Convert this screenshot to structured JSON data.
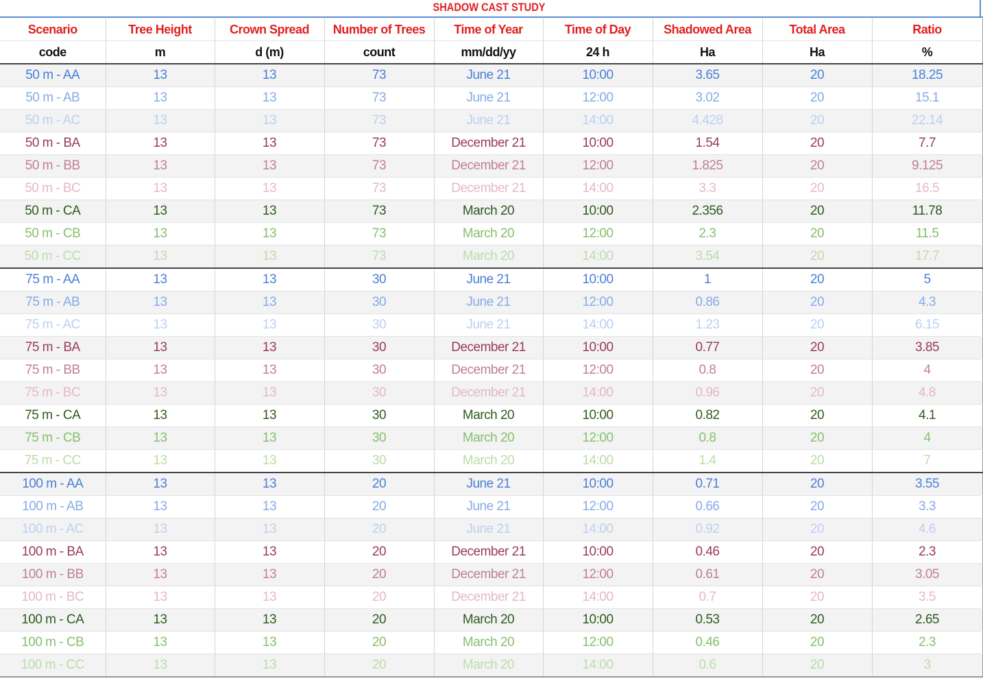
{
  "title": "SHADOW CAST STUDY",
  "colors": {
    "header_red": "#e02020",
    "AA": "#4a7fd8",
    "AB": "#86abe8",
    "AC": "#bcd0f2",
    "BA": "#9a3a5a",
    "BB": "#c07f98",
    "BC": "#e4b8c8",
    "CA": "#2e5b1e",
    "CB": "#86c06c",
    "CC": "#bcdcaa"
  },
  "headers": [
    "Scenario",
    "Tree Height",
    "Crown Spread",
    "Number of Trees",
    "Time of Year",
    "Time of Day",
    "Shadowed Area",
    "Total Area",
    "Ratio"
  ],
  "units": [
    "code",
    "m",
    "d (m)",
    "count",
    "mm/dd/yy",
    "24 h",
    "Ha",
    "Ha",
    "%"
  ],
  "rows": [
    {
      "tone": "AA",
      "cells": [
        "50 m - AA",
        "13",
        "13",
        "73",
        "June 21",
        "10:00",
        "3.65",
        "20",
        "18.25"
      ]
    },
    {
      "tone": "AB",
      "cells": [
        "50 m - AB",
        "13",
        "13",
        "73",
        "June 21",
        "12:00",
        "3.02",
        "20",
        "15.1"
      ]
    },
    {
      "tone": "AC",
      "cells": [
        "50 m - AC",
        "13",
        "13",
        "73",
        "June 21",
        "14:00",
        "4.428",
        "20",
        "22.14"
      ]
    },
    {
      "tone": "BA",
      "cells": [
        "50 m - BA",
        "13",
        "13",
        "73",
        "December 21",
        "10:00",
        "1.54",
        "20",
        "7.7"
      ]
    },
    {
      "tone": "BB",
      "cells": [
        "50 m - BB",
        "13",
        "13",
        "73",
        "December 21",
        "12:00",
        "1.825",
        "20",
        "9.125"
      ]
    },
    {
      "tone": "BC",
      "cells": [
        "50 m - BC",
        "13",
        "13",
        "73",
        "December 21",
        "14:00",
        "3.3",
        "20",
        "16.5"
      ]
    },
    {
      "tone": "CA",
      "cells": [
        "50 m - CA",
        "13",
        "13",
        "73",
        "March 20",
        "10:00",
        "2.356",
        "20",
        "11.78"
      ]
    },
    {
      "tone": "CB",
      "cells": [
        "50 m - CB",
        "13",
        "13",
        "73",
        "March 20",
        "12:00",
        "2.3",
        "20",
        "11.5"
      ]
    },
    {
      "tone": "CC",
      "cells": [
        "50 m - CC",
        "13",
        "13",
        "73",
        "March 20",
        "14:00",
        "3.54",
        "20",
        "17.7"
      ]
    },
    {
      "tone": "AA",
      "cells": [
        "75 m - AA",
        "13",
        "13",
        "30",
        "June 21",
        "10:00",
        "1",
        "20",
        "5"
      ]
    },
    {
      "tone": "AB",
      "cells": [
        "75 m - AB",
        "13",
        "13",
        "30",
        "June 21",
        "12:00",
        "0.86",
        "20",
        "4.3"
      ]
    },
    {
      "tone": "AC",
      "cells": [
        "75 m - AC",
        "13",
        "13",
        "30",
        "June 21",
        "14:00",
        "1.23",
        "20",
        "6.15"
      ]
    },
    {
      "tone": "BA",
      "cells": [
        "75 m - BA",
        "13",
        "13",
        "30",
        "December 21",
        "10:00",
        "0.77",
        "20",
        "3.85"
      ]
    },
    {
      "tone": "BB",
      "cells": [
        "75 m - BB",
        "13",
        "13",
        "30",
        "December 21",
        "12:00",
        "0.8",
        "20",
        "4"
      ]
    },
    {
      "tone": "BC",
      "cells": [
        "75 m - BC",
        "13",
        "13",
        "30",
        "December 21",
        "14:00",
        "0.96",
        "20",
        "4.8"
      ]
    },
    {
      "tone": "CA",
      "cells": [
        "75 m - CA",
        "13",
        "13",
        "30",
        "March 20",
        "10:00",
        "0.82",
        "20",
        "4.1"
      ]
    },
    {
      "tone": "CB",
      "cells": [
        "75 m - CB",
        "13",
        "13",
        "30",
        "March 20",
        "12:00",
        "0.8",
        "20",
        "4"
      ]
    },
    {
      "tone": "CC",
      "cells": [
        "75 m - CC",
        "13",
        "13",
        "30",
        "March 20",
        "14:00",
        "1.4",
        "20",
        "7"
      ]
    },
    {
      "tone": "AA",
      "cells": [
        "100 m - AA",
        "13",
        "13",
        "20",
        "June 21",
        "10:00",
        "0.71",
        "20",
        "3.55"
      ]
    },
    {
      "tone": "AB",
      "cells": [
        "100 m - AB",
        "13",
        "13",
        "20",
        "June 21",
        "12:00",
        "0.66",
        "20",
        "3.3"
      ]
    },
    {
      "tone": "AC",
      "cells": [
        "100 m - AC",
        "13",
        "13",
        "20",
        "June 21",
        "14:00",
        "0.92",
        "20",
        "4.6"
      ]
    },
    {
      "tone": "BA",
      "cells": [
        "100 m - BA",
        "13",
        "13",
        "20",
        "December 21",
        "10:00",
        "0.46",
        "20",
        "2.3"
      ]
    },
    {
      "tone": "BB",
      "cells": [
        "100 m - BB",
        "13",
        "13",
        "20",
        "December 21",
        "12:00",
        "0.61",
        "20",
        "3.05"
      ]
    },
    {
      "tone": "BC",
      "cells": [
        "100 m - BC",
        "13",
        "13",
        "20",
        "December 21",
        "14:00",
        "0.7",
        "20",
        "3.5"
      ]
    },
    {
      "tone": "CA",
      "cells": [
        "100 m - CA",
        "13",
        "13",
        "20",
        "March 20",
        "10:00",
        "0.53",
        "20",
        "2.65"
      ]
    },
    {
      "tone": "CB",
      "cells": [
        "100 m - CB",
        "13",
        "13",
        "20",
        "March 20",
        "12:00",
        "0.46",
        "20",
        "2.3"
      ]
    },
    {
      "tone": "CC",
      "cells": [
        "100 m - CC",
        "13",
        "13",
        "20",
        "March 20",
        "14:00",
        "0.6",
        "20",
        "3"
      ]
    }
  ]
}
